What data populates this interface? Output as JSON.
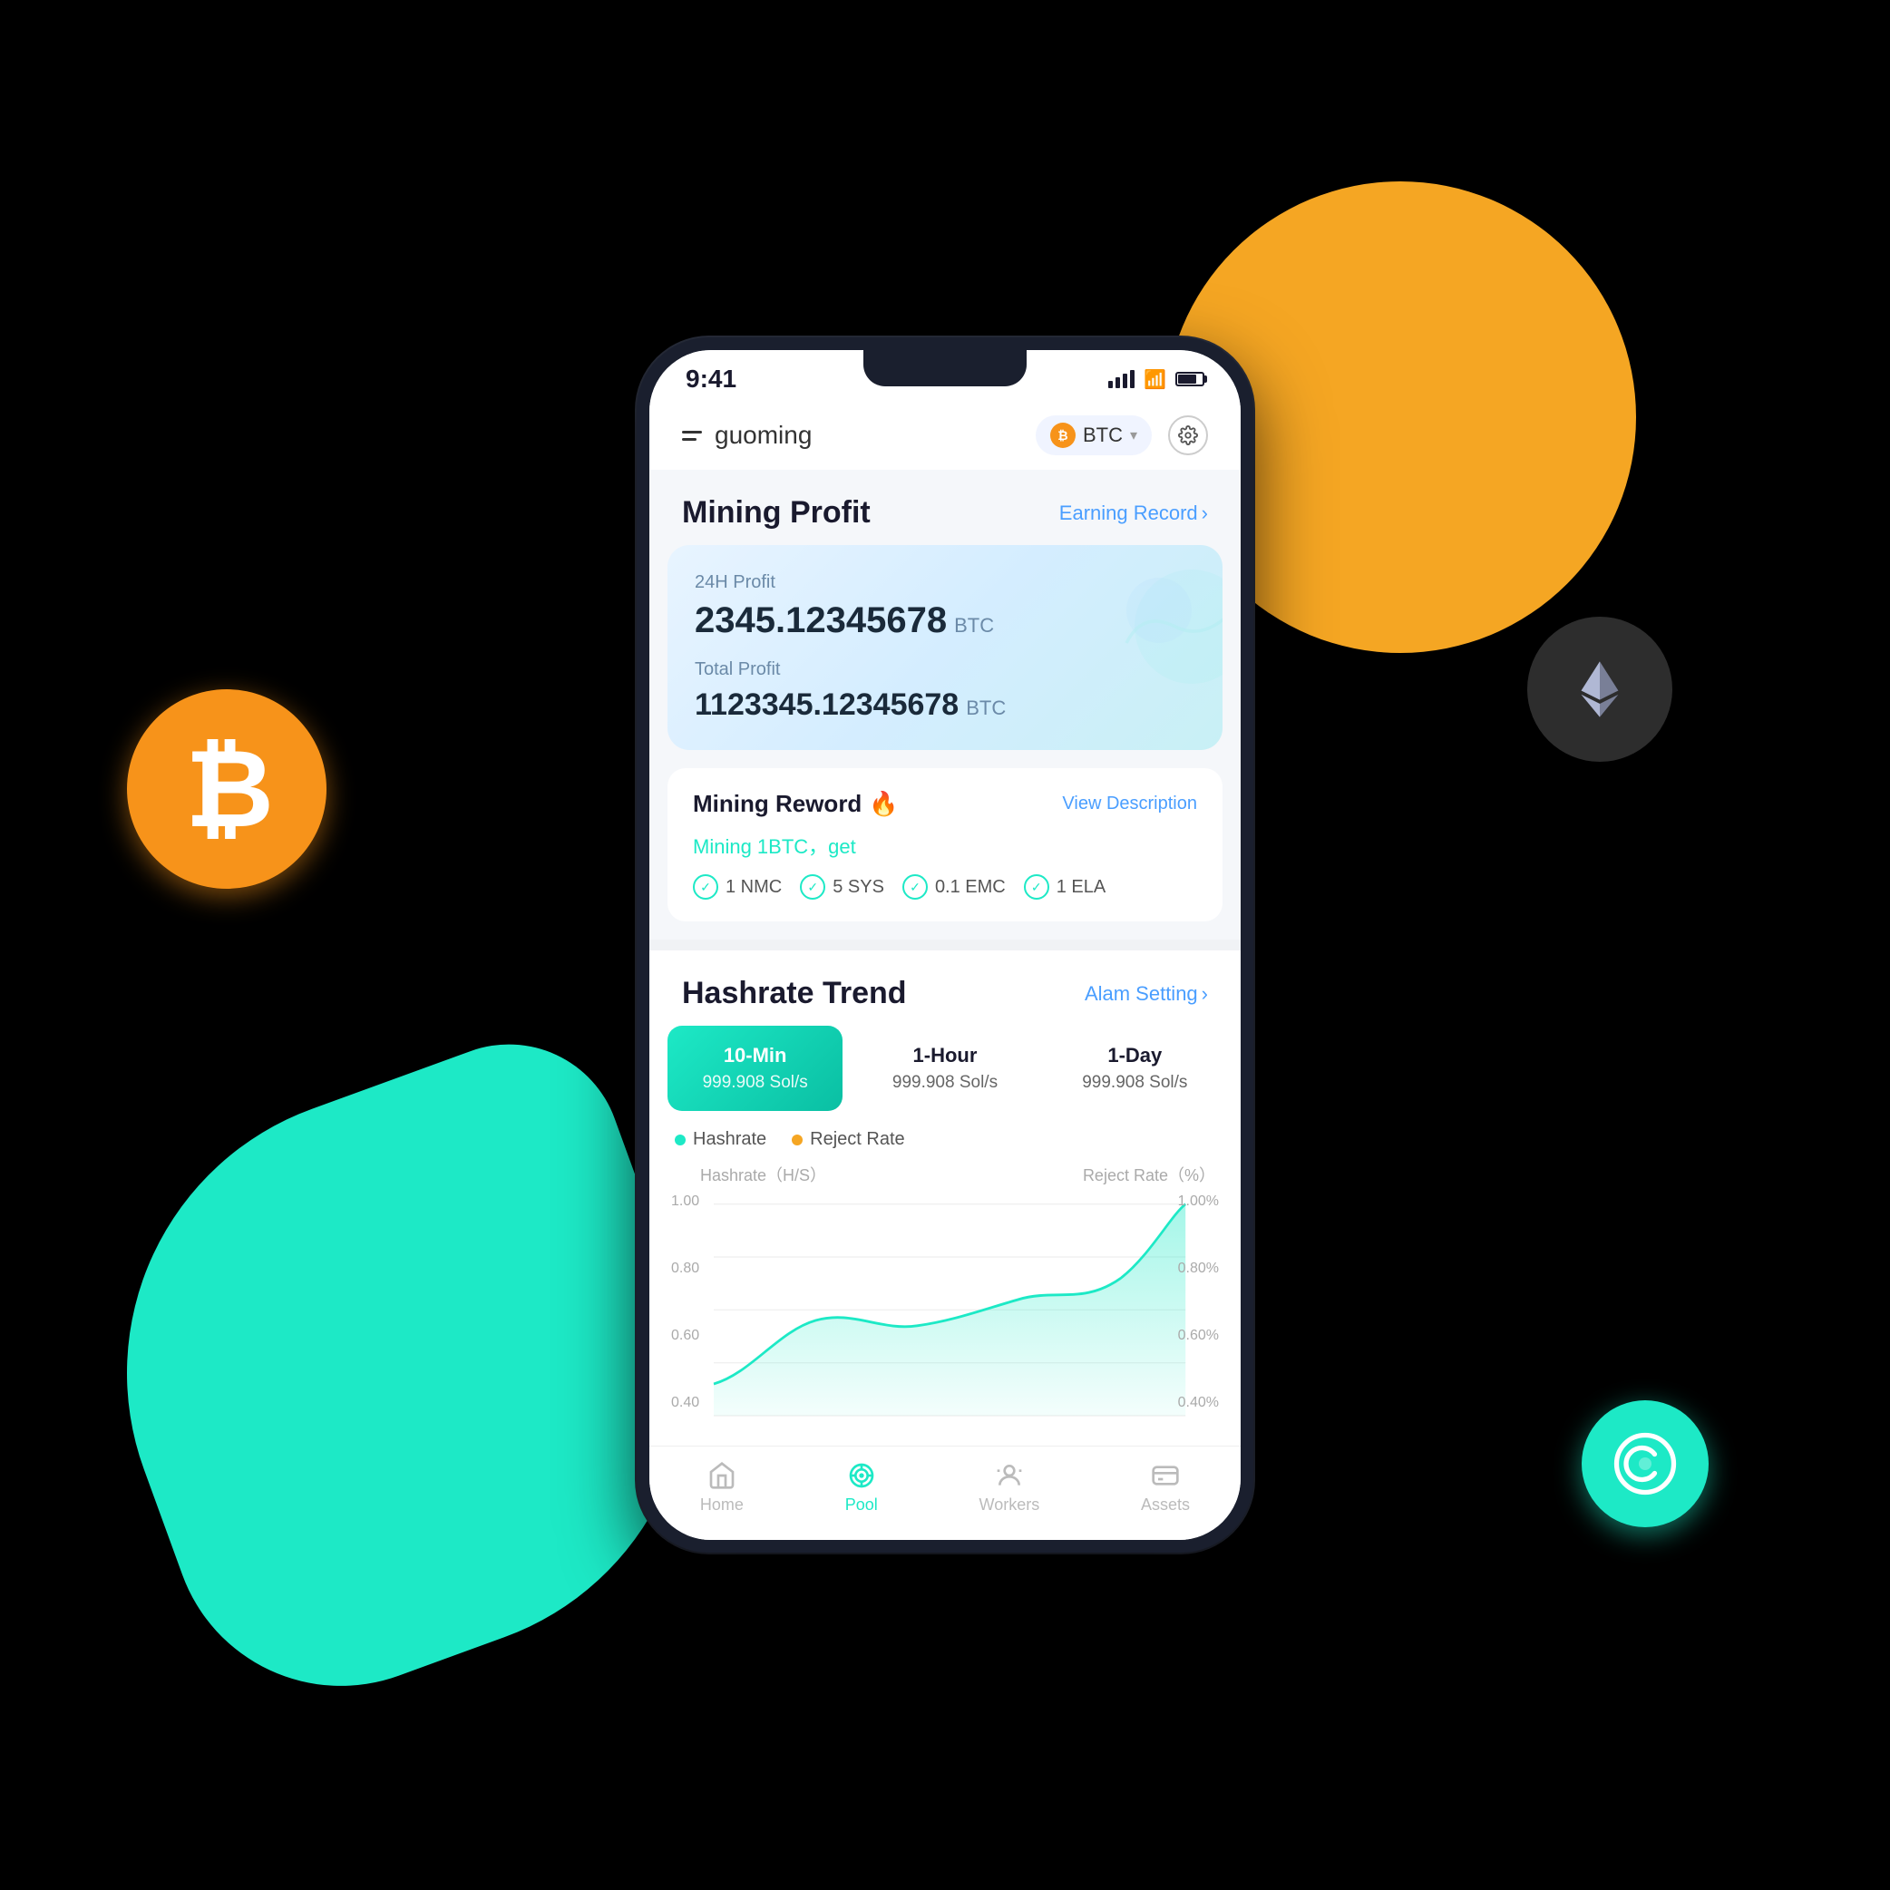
{
  "scene": {
    "background_color": "#000000"
  },
  "status_bar": {
    "time": "9:41",
    "signal_alt": "signal",
    "wifi_alt": "wifi",
    "battery_alt": "battery"
  },
  "header": {
    "menu_alt": "menu",
    "username": "guoming",
    "currency": "BTC",
    "settings_alt": "settings"
  },
  "mining_profit": {
    "title": "Mining Profit",
    "earning_record_label": "Earning Record",
    "profit_24h_label": "24H Profit",
    "profit_24h_amount": "2345.12345678",
    "profit_24h_currency": "BTC",
    "total_profit_label": "Total Profit",
    "total_profit_amount": "1123345.12345678",
    "total_profit_currency": "BTC"
  },
  "mining_reward": {
    "title": "Mining Reword",
    "fire_emoji": "🔥",
    "view_description_label": "View Description",
    "subtitle": "Mining 1BTC，get",
    "items": [
      {
        "value": "1 NMC"
      },
      {
        "value": "5 SYS"
      },
      {
        "value": "0.1 EMC"
      },
      {
        "value": "1 ELA"
      }
    ]
  },
  "hashrate_trend": {
    "title": "Hashrate Trend",
    "alarm_setting_label": "Alam Setting",
    "cards": [
      {
        "label": "10-Min",
        "value": "999.908 Sol/s",
        "active": true
      },
      {
        "label": "1-Hour",
        "value": "999.908 Sol/s",
        "active": false
      },
      {
        "label": "1-Day",
        "value": "999.908 Sol/s",
        "active": false
      }
    ],
    "legend": [
      {
        "label": "Hashrate",
        "color": "teal"
      },
      {
        "label": "Reject Rate",
        "color": "orange"
      }
    ],
    "y_axis_left_label": "Hashrate（H/S）",
    "y_axis_right_label": "Reject Rate（%）",
    "y_left_values": [
      "1.00",
      "0.80",
      "0.60",
      "0.40"
    ],
    "y_right_values": [
      "1.00%",
      "0.80%",
      "0.60%",
      "0.40%"
    ]
  },
  "bottom_nav": {
    "items": [
      {
        "label": "Home",
        "icon": "🏠",
        "active": false
      },
      {
        "label": "Pool",
        "icon": "⚙",
        "active": true
      },
      {
        "label": "Workers",
        "icon": "🔧",
        "active": false
      },
      {
        "label": "Assets",
        "icon": "💳",
        "active": false
      }
    ]
  }
}
